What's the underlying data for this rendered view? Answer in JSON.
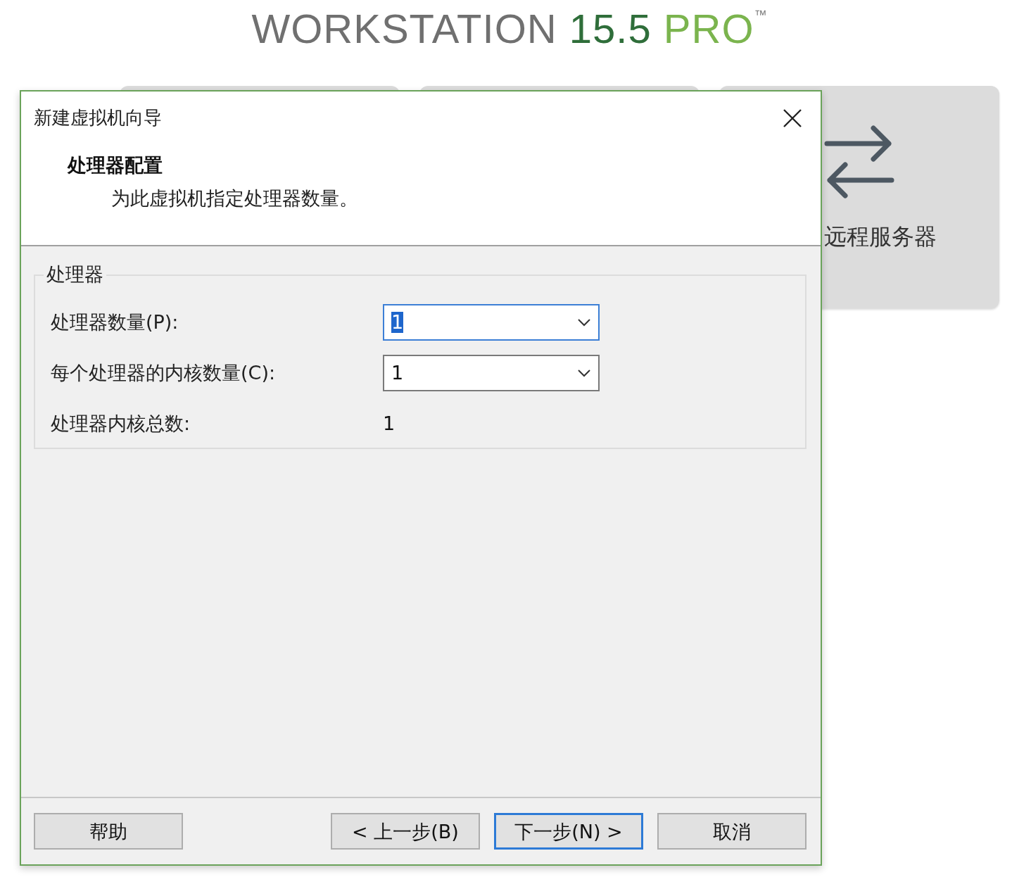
{
  "logo": {
    "product": "WORKSTATION",
    "version": "15.5",
    "edition": "PRO",
    "trademark": "™"
  },
  "remote_server_card": {
    "label": "远程服务器"
  },
  "dialog": {
    "title": "新建虚拟机向导",
    "heading": "处理器配置",
    "subheading": "为此虚拟机指定处理器数量。",
    "group": {
      "legend": "处理器",
      "rows": [
        {
          "kind": "combo",
          "label": "处理器数量(P):",
          "value": "1",
          "focused": true
        },
        {
          "kind": "combo",
          "label": "每个处理器的内核数量(C):",
          "value": "1",
          "focused": false
        },
        {
          "kind": "text",
          "label": "处理器内核总数:",
          "value": "1"
        }
      ]
    },
    "buttons": [
      {
        "label": "帮助",
        "default": false
      },
      {
        "label": "< 上一步(B)",
        "default": false
      },
      {
        "label": "下一步(N) >",
        "default": true
      },
      {
        "label": "取消",
        "default": false
      }
    ]
  }
}
